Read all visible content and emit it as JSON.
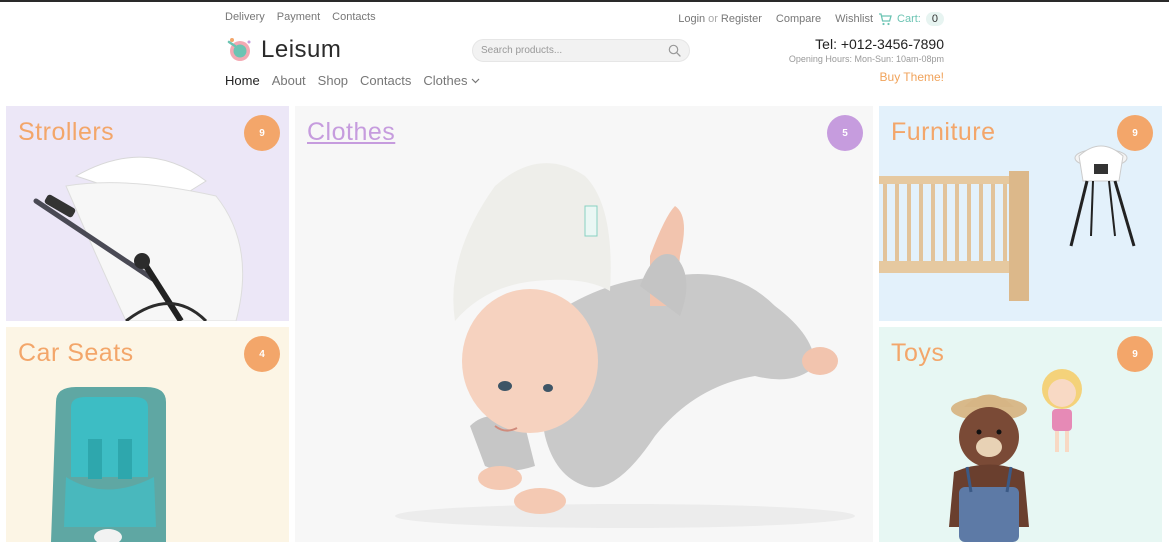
{
  "topbar": {
    "links": [
      "Delivery",
      "Payment",
      "Contacts"
    ],
    "login": "Login",
    "or": "or",
    "register": "Register",
    "compare": "Compare",
    "wishlist": "Wishlist",
    "cart_label": "Cart:",
    "cart_count": "0"
  },
  "brand": {
    "name": "Leisum"
  },
  "search": {
    "placeholder": "Search products..."
  },
  "contact": {
    "phone": "Tel: +012-3456-7890",
    "hours": "Opening Hours: Mon-Sun: 10am-08pm",
    "buy": "Buy Theme!"
  },
  "nav": {
    "items": [
      "Home",
      "About",
      "Shop",
      "Contacts",
      "Clothes"
    ],
    "active": "Home"
  },
  "categories": {
    "strollers": {
      "title": "Strollers",
      "count": "9"
    },
    "carseats": {
      "title": "Car Seats",
      "count": "4"
    },
    "clothes": {
      "title": "Clothes",
      "count": "5"
    },
    "furniture": {
      "title": "Furniture",
      "count": "9"
    },
    "toys": {
      "title": "Toys",
      "count": "9"
    }
  },
  "colors": {
    "accent_orange": "#f3a66a",
    "accent_purple": "#c69cde",
    "accent_teal": "#6cc4b3"
  },
  "icons": {
    "search": "search-icon",
    "cart": "cart-icon",
    "dropdown": "chevron-down-icon"
  }
}
